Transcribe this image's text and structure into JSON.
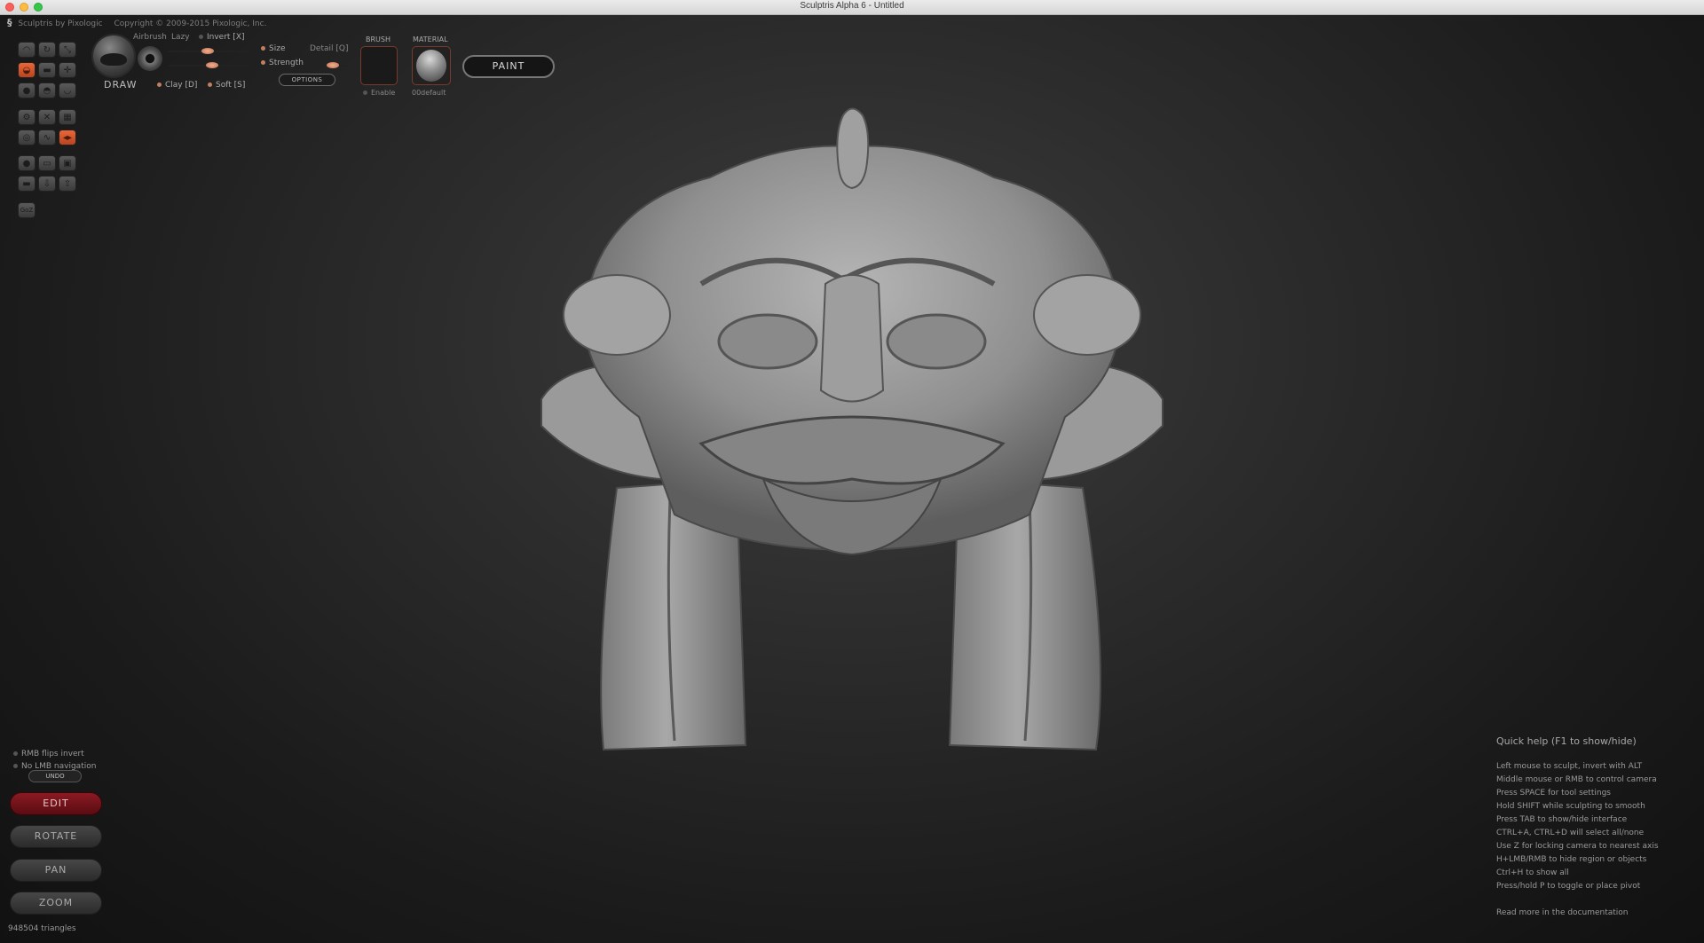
{
  "window": {
    "title": "Sculptris Alpha 6 - Untitled"
  },
  "header": {
    "app_name": "Sculptris by Pixologic",
    "copyright": "Copyright © 2009-2015 Pixologic, Inc."
  },
  "brush_panel": {
    "tool_name": "DRAW",
    "airbrush_label": "Airbrush",
    "lazy_label": "Lazy",
    "invert_label": "Invert [X]",
    "size_label": "Size",
    "detail_label": "Detail [Q]",
    "strength_label": "Strength",
    "options_label": "OPTIONS",
    "clay_label": "Clay [D]",
    "soft_label": "Soft [S]",
    "size_value": 0.5,
    "strength_value": 0.55,
    "detail_value": 0.6
  },
  "brush_section": {
    "label": "BRUSH",
    "enable_label": "Enable"
  },
  "material_section": {
    "label": "MATERIAL",
    "material_name": "00default"
  },
  "paint_button": {
    "label": "PAINT"
  },
  "options": {
    "rmb_flips_invert": "RMB flips invert",
    "no_lmb_navigation": "No LMB navigation"
  },
  "nav_buttons": {
    "undo": "UNDO",
    "edit": "EDIT",
    "rotate": "ROTATE",
    "pan": "PAN",
    "zoom": "ZOOM"
  },
  "status": {
    "triangles": "948504 triangles"
  },
  "quick_help": {
    "title": "Quick help (F1 to show/hide)",
    "lines": [
      "Left mouse to sculpt, invert with ALT",
      "Middle mouse or RMB to control camera",
      "Press SPACE for tool settings",
      "Hold SHIFT while sculpting to smooth",
      "Press TAB to show/hide interface",
      "CTRL+A, CTRL+D will select all/none",
      "Use Z for locking camera to nearest axis",
      "H+LMB/RMB to hide region or objects",
      "Ctrl+H to show all",
      "Press/hold P to toggle or place pivot"
    ],
    "doc_link": "Read more in the documentation"
  },
  "tools": [
    {
      "icon": "crease-icon",
      "active": false
    },
    {
      "icon": "rotate-icon",
      "active": false
    },
    {
      "icon": "scale-icon",
      "active": false
    },
    {
      "icon": "draw-icon",
      "active": true
    },
    {
      "icon": "flatten-icon",
      "active": false
    },
    {
      "icon": "pinch-icon",
      "active": false
    },
    {
      "icon": "inflate-icon",
      "active": false
    },
    {
      "icon": "grab-icon",
      "active": false
    },
    {
      "icon": "smooth-icon",
      "active": false
    },
    {
      "icon": "reduce-brush-icon",
      "active": false
    },
    {
      "icon": "reduce-selected-icon",
      "active": false
    },
    {
      "icon": "subdivide-icon",
      "active": false
    },
    {
      "icon": "mask-icon",
      "active": false
    },
    {
      "icon": "wire-icon",
      "active": false
    },
    {
      "icon": "symmetry-icon",
      "active": true
    },
    {
      "icon": "sphere-icon",
      "active": false
    },
    {
      "icon": "plane-icon",
      "active": false
    },
    {
      "icon": "save-icon",
      "active": false
    },
    {
      "icon": "open-icon",
      "active": false
    },
    {
      "icon": "export-icon",
      "active": false
    },
    {
      "icon": "import-icon",
      "active": false
    },
    {
      "icon": "goz-icon",
      "active": false
    }
  ],
  "colors": {
    "accent_orange": "#d65a30",
    "edit_red": "#7a1620"
  }
}
